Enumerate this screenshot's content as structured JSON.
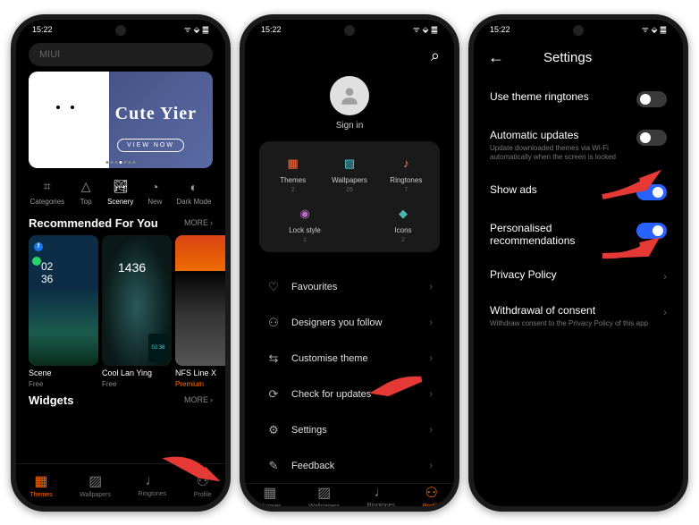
{
  "statusbar": {
    "time": "15:22",
    "signals": "⇅ ✦ G ⋯",
    "right": "ᯤ ⬙ ䷀"
  },
  "phone1": {
    "search_placeholder": "MIUI",
    "banner": {
      "title": "Cute Yier",
      "cta": "VIEW NOW"
    },
    "tabs": [
      {
        "icon": "⌗",
        "label": "Categories"
      },
      {
        "icon": "△",
        "label": "Top"
      },
      {
        "icon": "🏞",
        "label": "Scenery"
      },
      {
        "icon": "◔",
        "label": "New"
      },
      {
        "icon": "◐",
        "label": "Dark Mode"
      }
    ],
    "recommended_title": "Recommended For You",
    "more": "MORE",
    "themes": [
      {
        "name": "Scene",
        "price": "Free",
        "premium": false
      },
      {
        "name": "Cool Lan Ying",
        "price": "Free",
        "premium": false
      },
      {
        "name": "NFS Line X",
        "price": "Premium",
        "premium": true
      }
    ],
    "widgets_title": "Widgets",
    "nav": [
      {
        "label": "Themes"
      },
      {
        "label": "Wallpapers"
      },
      {
        "label": "Ringtones"
      },
      {
        "label": "Profile"
      }
    ]
  },
  "phone2": {
    "signin": "Sign in",
    "grid": [
      {
        "label": "Themes",
        "count": "2",
        "color": "#ff7043",
        "icon": "▦"
      },
      {
        "label": "Wallpapers",
        "count": "26",
        "color": "#4dd0e1",
        "icon": "▨"
      },
      {
        "label": "Ringtones",
        "count": "7",
        "color": "#ff8a65",
        "icon": "♪"
      },
      {
        "label": "Lock style",
        "count": "1",
        "color": "#ba68c8",
        "icon": "◉"
      },
      {
        "label": "Icons",
        "count": "2",
        "color": "#4db6ac",
        "icon": "◆"
      }
    ],
    "menu": [
      {
        "icon": "♡",
        "label": "Favourites"
      },
      {
        "icon": "⚇",
        "label": "Designers you follow"
      },
      {
        "icon": "⇆",
        "label": "Customise theme"
      },
      {
        "icon": "⟳",
        "label": "Check for updates"
      },
      {
        "icon": "⚙",
        "label": "Settings"
      },
      {
        "icon": "✎",
        "label": "Feedback"
      }
    ],
    "nav": [
      {
        "label": "Themes"
      },
      {
        "label": "Wallpapers"
      },
      {
        "label": "Ringtones"
      },
      {
        "label": "Profile"
      }
    ]
  },
  "phone3": {
    "title": "Settings",
    "items": [
      {
        "label": "Use theme ringtones",
        "type": "toggle",
        "on": false
      },
      {
        "label": "Automatic updates",
        "desc": "Update downloaded themes via Wi-Fi automatically when the screen is locked",
        "type": "toggle",
        "on": false
      },
      {
        "label": "Show ads",
        "type": "toggle",
        "on": true
      },
      {
        "label": "Personalised recommendations",
        "type": "toggle",
        "on": true
      },
      {
        "label": "Privacy Policy",
        "type": "link"
      },
      {
        "label": "Withdrawal of consent",
        "desc": "Withdraw consent to the Privacy Policy of this app",
        "type": "link"
      }
    ]
  }
}
